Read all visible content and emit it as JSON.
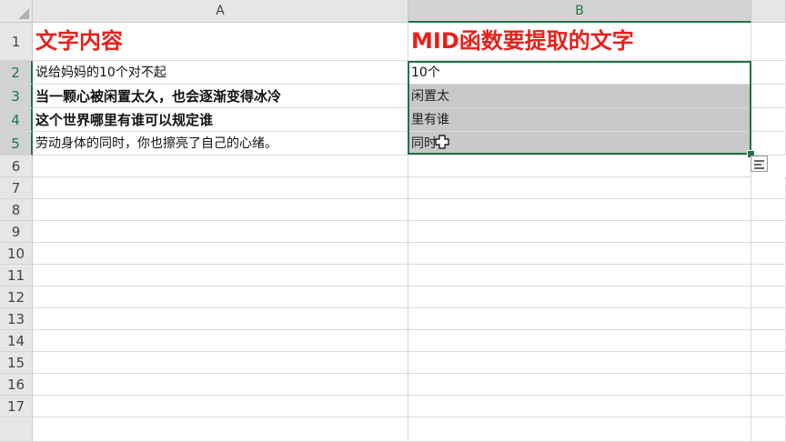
{
  "columns": [
    "A",
    "B"
  ],
  "rows": [
    "1",
    "2",
    "3",
    "4",
    "5",
    "6",
    "7",
    "8",
    "9",
    "10",
    "11",
    "12",
    "13",
    "14",
    "15",
    "16",
    "17"
  ],
  "cells": {
    "A1": "文字内容",
    "B1": "MID函数要提取的文字",
    "A2": "说给妈妈的10个对不起",
    "A3": "当一颗心被闲置太久，也会逐渐变得冰冷",
    "A4": "这个世界哪里有谁可以规定谁",
    "A5": "劳动身体的同时，你也擦亮了自己的心绪。",
    "B2": "10个",
    "B3": "闲置太",
    "B4": "里有谁",
    "B5": "同时"
  },
  "selection": "B2:B5",
  "colors": {
    "title": "#e8201a",
    "accent": "#217346",
    "selection_fill": "#c8c8c8"
  },
  "icons": [
    "quick-analysis-icon",
    "fill-handle",
    "move-cursor-icon"
  ]
}
